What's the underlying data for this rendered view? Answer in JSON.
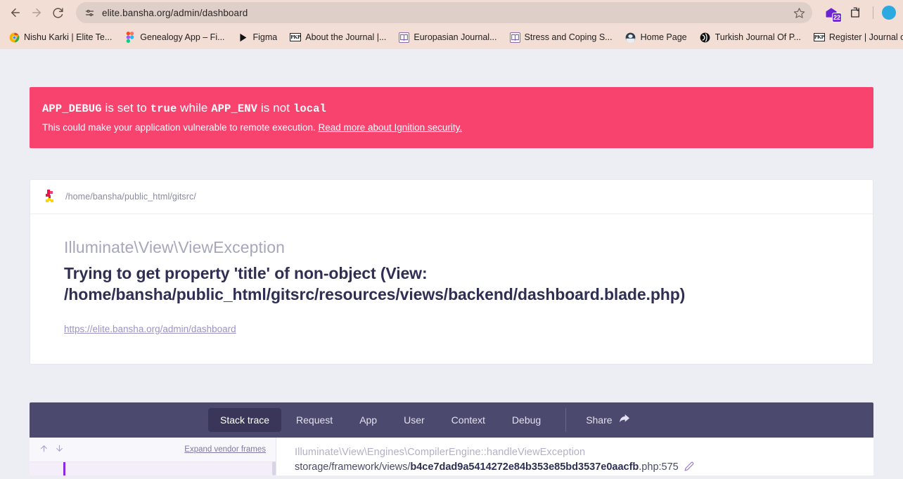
{
  "browser": {
    "back_tooltip": "Back",
    "forward_tooltip": "Forward",
    "reload_tooltip": "Reload",
    "site_info_tooltip": "View site information",
    "url": "elite.bansha.org/admin/dashboard",
    "bookmark_star_tooltip": "Bookmark this tab",
    "extension_badge_count": "22",
    "bookmarks": [
      {
        "label": "Nishu Karki | Elite Te...",
        "icon": "chrome-icon"
      },
      {
        "label": "Genealogy App – Fi...",
        "icon": "figma-icon"
      },
      {
        "label": "Figma",
        "icon": "play-icon"
      },
      {
        "label": "About the Journal |...",
        "icon": "pkp-icon"
      },
      {
        "label": "Europasian Journal...",
        "icon": "book-icon"
      },
      {
        "label": "Stress and Coping S...",
        "icon": "book-icon"
      },
      {
        "label": "Home Page",
        "icon": "globe-dark-icon"
      },
      {
        "label": "Turkish Journal Of P...",
        "icon": "globe-black-icon"
      },
      {
        "label": "Register | Journal of...",
        "icon": "pkp-icon"
      }
    ]
  },
  "security_banner": {
    "title_part1": "APP_DEBUG",
    "title_code1": "APP_DEBUG",
    "title_mid1": " is set to ",
    "title_code2": "true",
    "title_mid2": " while ",
    "title_code3": "APP_ENV",
    "title_mid3": " is not ",
    "title_code4": "local",
    "description": "This could make your application vulnerable to remote execution.",
    "link_text": "Read more about Ignition security.",
    "background_color": "#f8436f"
  },
  "exception_card": {
    "logo_name": "ignition-logo",
    "project_path": "/home/bansha/public_html/gitsrc/",
    "exception_class": "Illuminate\\View\\ViewException",
    "exception_message": "Trying to get property 'title' of non-object (View: /home/bansha/public_html/gitsrc/resources/views/backend/dashboard.blade.php)",
    "request_url": "https://elite.bansha.org/admin/dashboard"
  },
  "tabs": {
    "items": [
      {
        "label": "Stack trace",
        "active": true
      },
      {
        "label": "Request",
        "active": false
      },
      {
        "label": "App",
        "active": false
      },
      {
        "label": "User",
        "active": false
      },
      {
        "label": "Context",
        "active": false
      },
      {
        "label": "Debug",
        "active": false
      }
    ],
    "share_label": "Share",
    "share_icon": "share-arrow-icon",
    "active_background": "#3a3659",
    "bar_background": "#4c496e"
  },
  "stack_trace": {
    "nav_up_icon": "arrow-up-icon",
    "nav_down_icon": "arrow-down-icon",
    "expand_vendor_label": "Expand vendor frames",
    "frames": [
      {
        "class": "Illuminate\\View\\Engines\\CompilerEngine::handleViewException",
        "file_prefix": "storage/framework/views/",
        "file_hash": "b4ce7dad9a5414272e84b353e85bd3537e0aacfb",
        "file_suffix": ".php:575",
        "edit_icon": "pencil-icon"
      }
    ]
  }
}
